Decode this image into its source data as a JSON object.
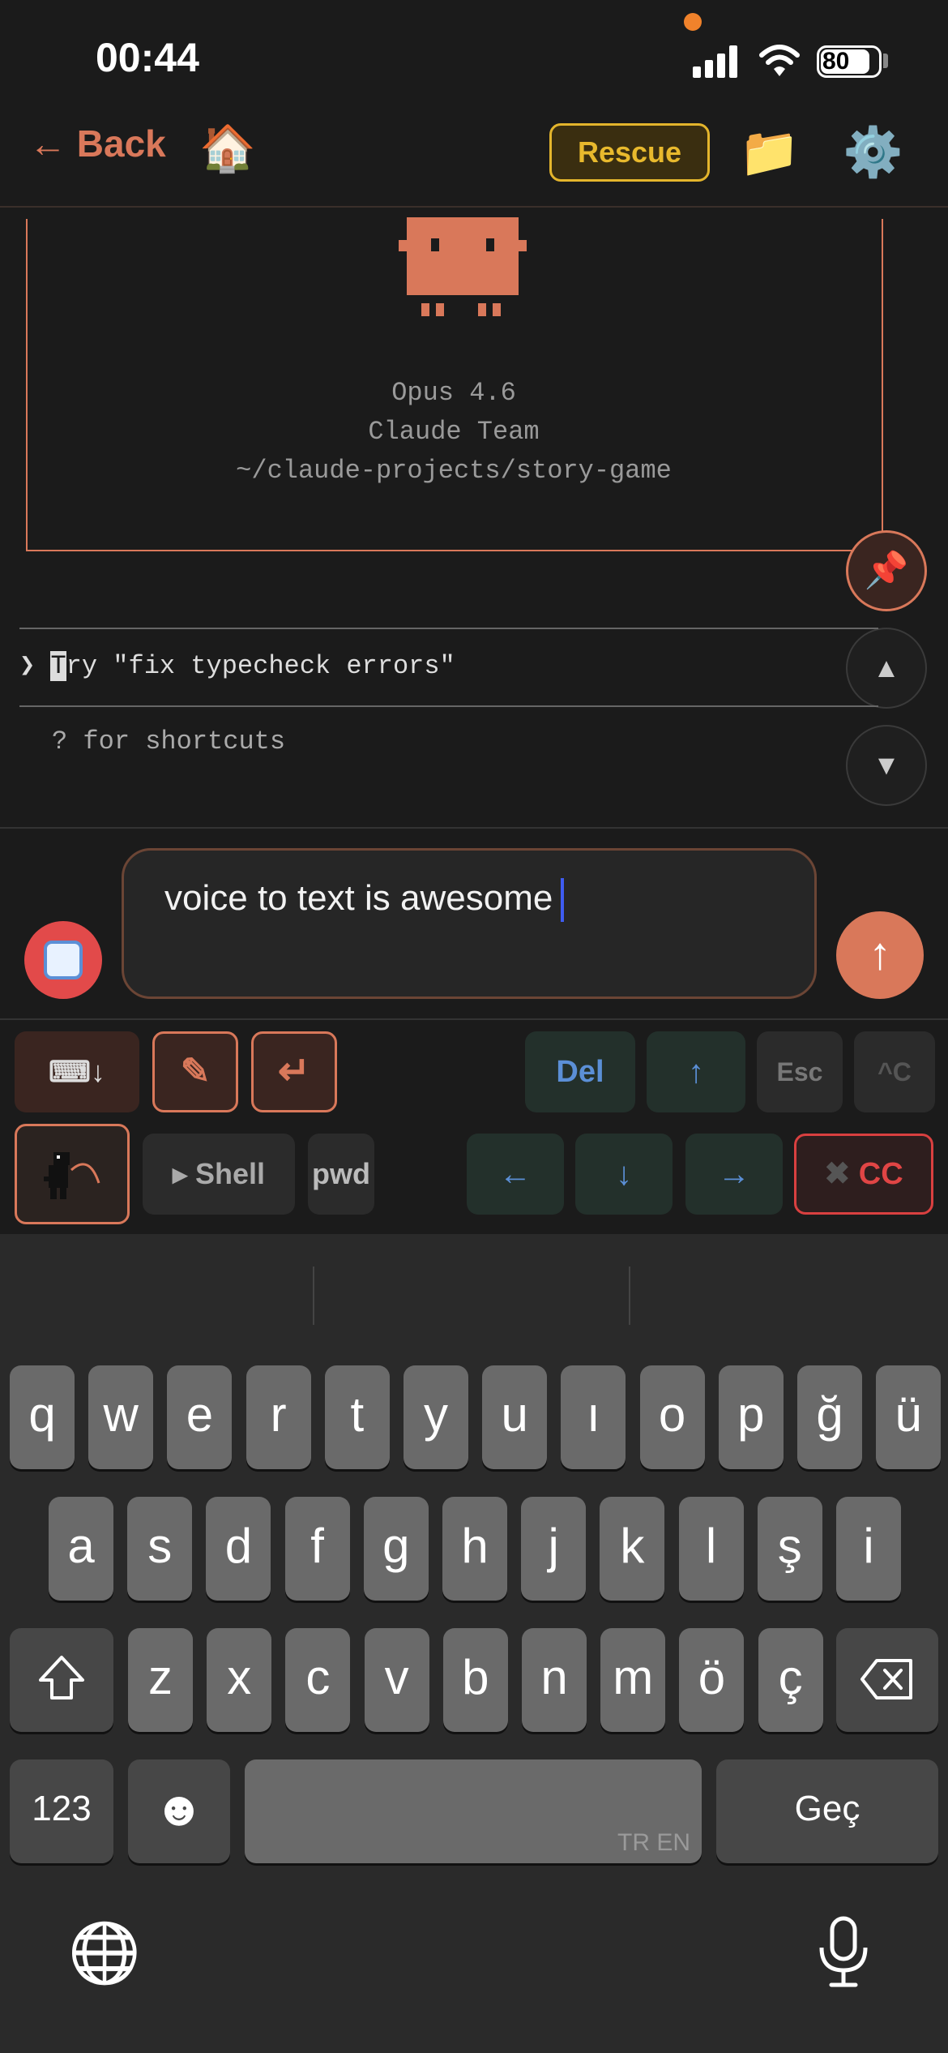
{
  "status_bar": {
    "time": "00:44",
    "battery": "80"
  },
  "header": {
    "back_label": "Back",
    "home_icon": "🏠",
    "rescue_label": "Rescue",
    "folder_icon": "📁",
    "gear_icon": "⚙️",
    "colors": {
      "accent": "#d9785a",
      "rescue": "#e4b52c"
    }
  },
  "terminal": {
    "model": "Opus 4.6",
    "team": "Claude Team",
    "path": "~/claude-projects/story-game",
    "prompt_symbol": "❯",
    "placeholder_first": "T",
    "placeholder_rest": "ry \"fix typecheck errors\"",
    "hint": "? for shortcuts"
  },
  "side_buttons": {
    "pin_icon": "📌",
    "up_icon": "▲",
    "down_icon": "▼"
  },
  "composer": {
    "text": "voice to text is awesome",
    "send_icon": "↑"
  },
  "toolbar": {
    "row1": {
      "keyboard_icon": "⌨↓",
      "pencil_icon": "✎",
      "enter_icon": "↵",
      "del": "Del",
      "up": "↑",
      "esc": "Esc",
      "ctrl_c": "^C"
    },
    "row2": {
      "shell": "▸ Shell",
      "pwd": "pwd",
      "left": "←",
      "down": "↓",
      "right": "→",
      "cc_x": "✖",
      "cc": "CC"
    }
  },
  "keyboard": {
    "row1": [
      "q",
      "w",
      "e",
      "r",
      "t",
      "y",
      "u",
      "ı",
      "o",
      "p",
      "ğ",
      "ü"
    ],
    "row2": [
      "a",
      "s",
      "d",
      "f",
      "g",
      "h",
      "j",
      "k",
      "l",
      "ş",
      "i"
    ],
    "row3": [
      "z",
      "x",
      "c",
      "v",
      "b",
      "n",
      "m",
      "ö",
      "ç"
    ],
    "numbers": "123",
    "emoji_icon": "☻",
    "space_lang": "TR EN",
    "return": "Geç",
    "globe_icon": "🌐",
    "mic_icon": "🎙"
  }
}
